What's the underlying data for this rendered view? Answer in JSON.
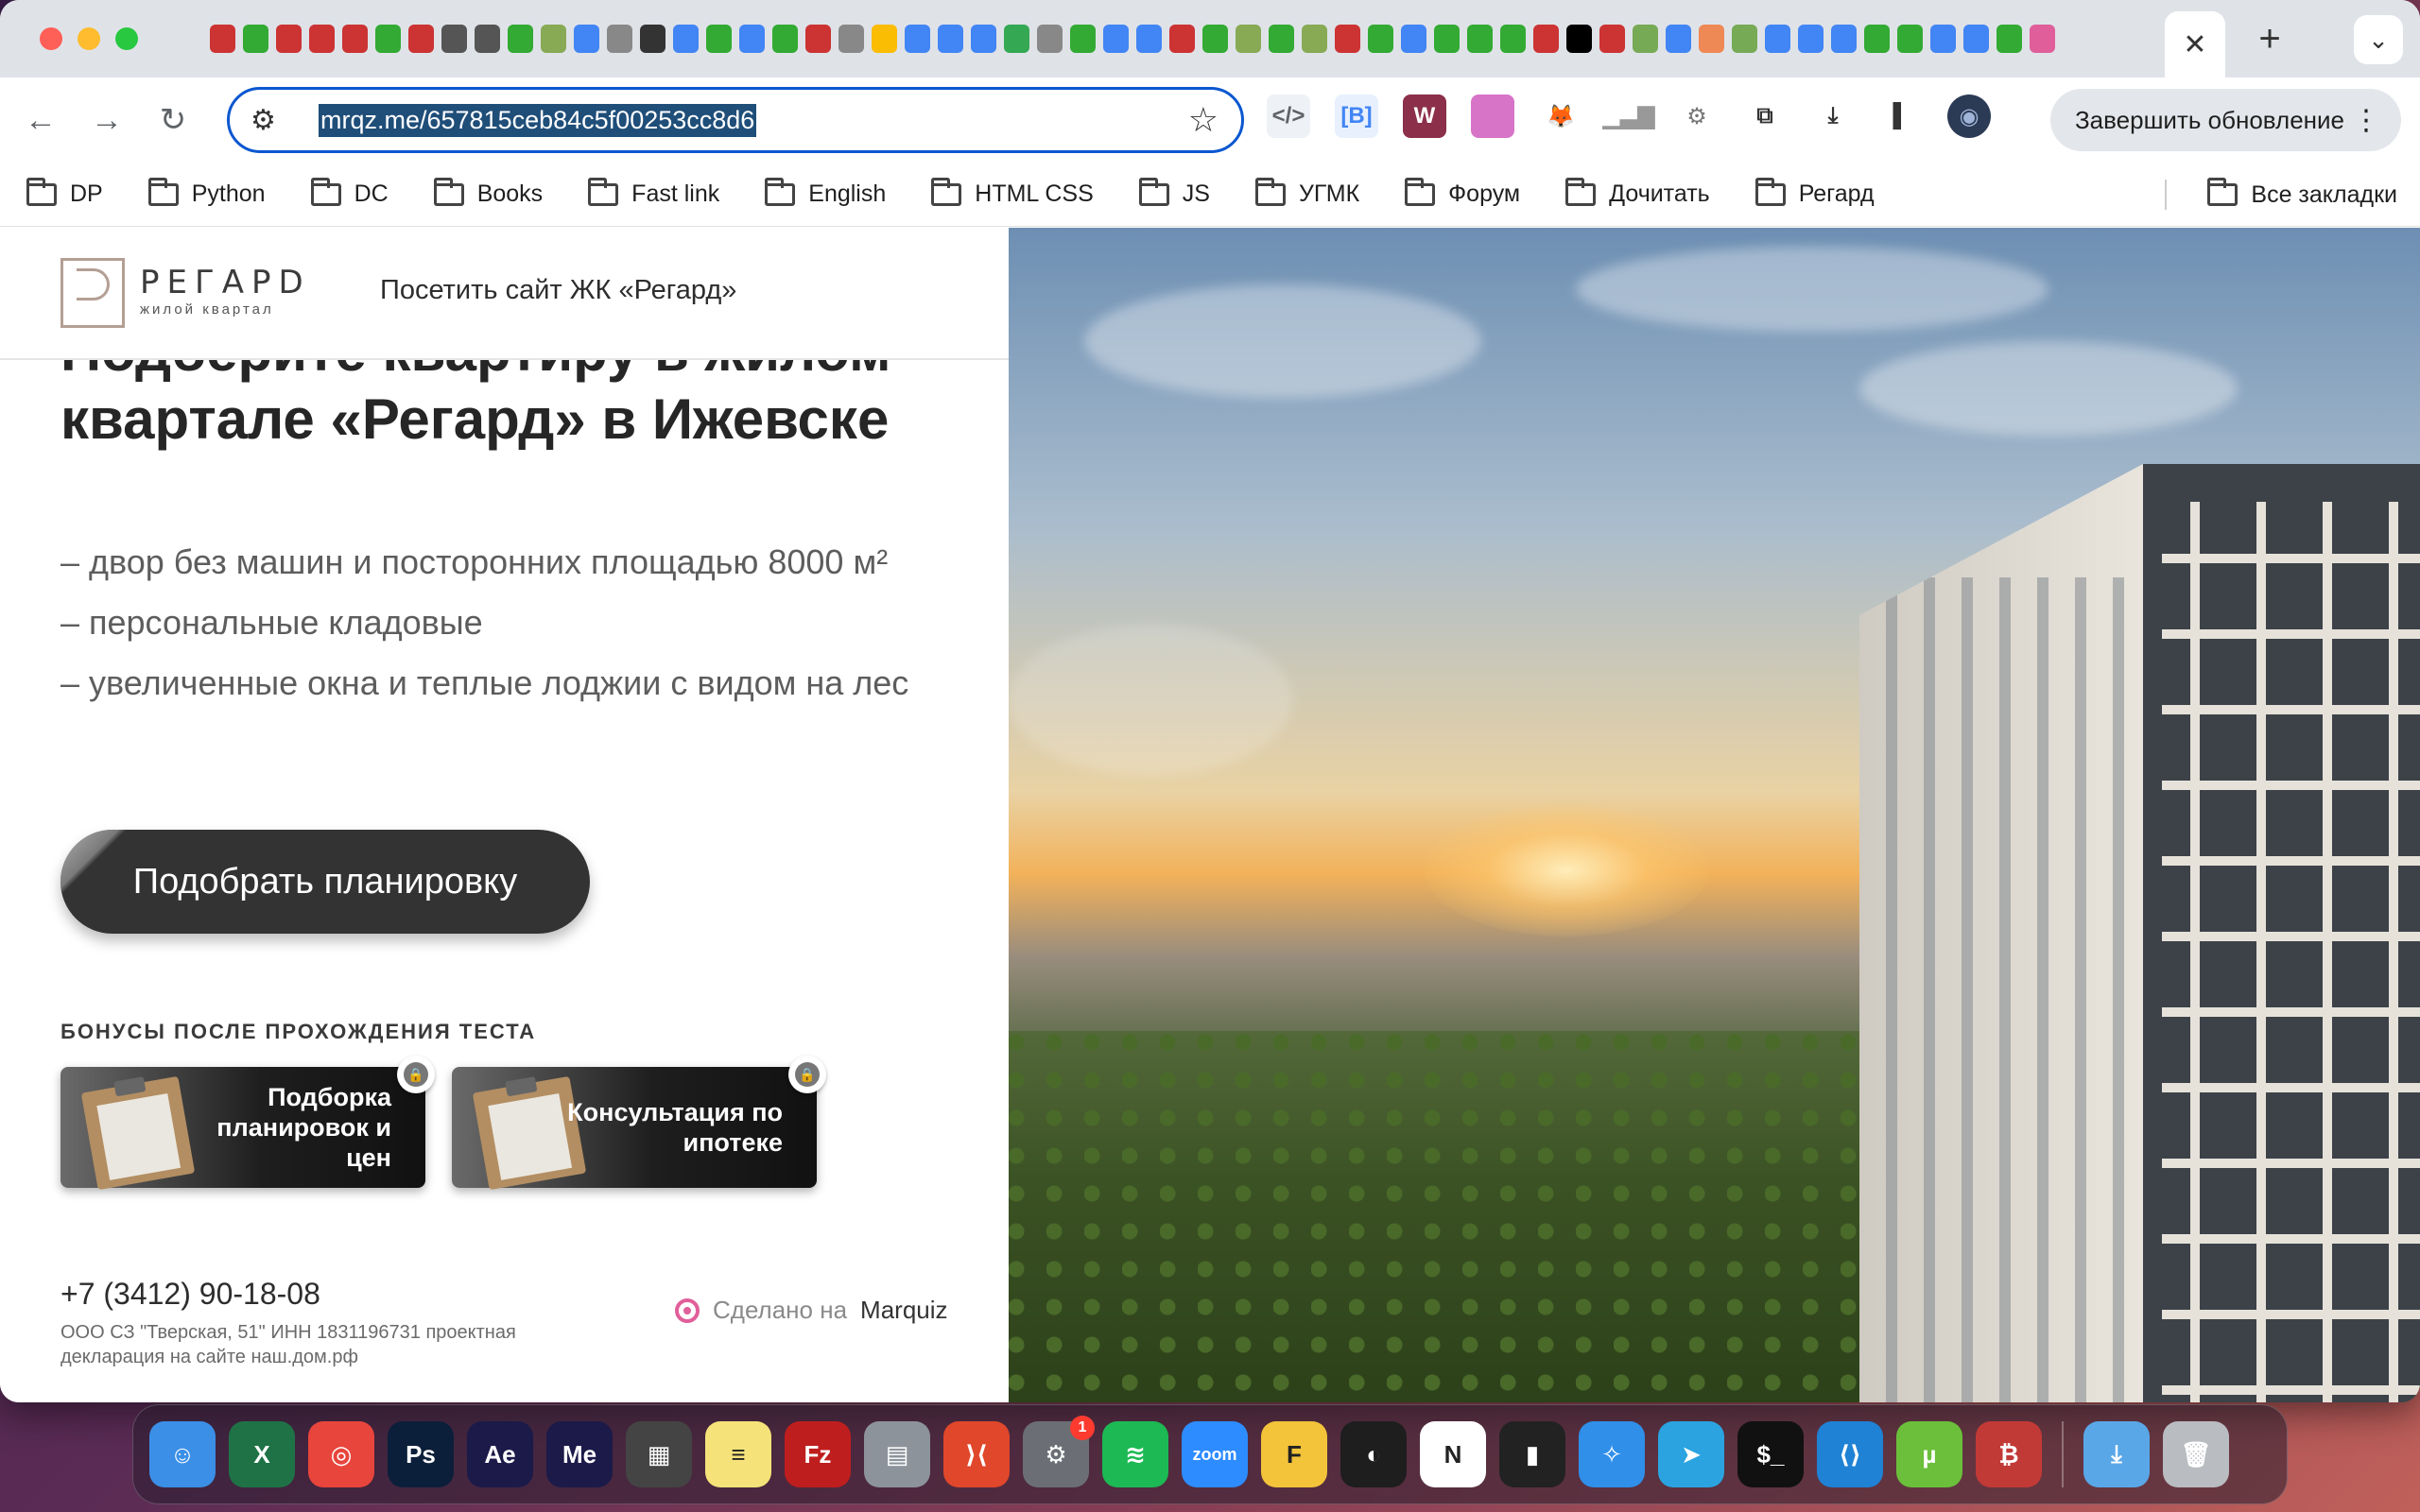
{
  "browser": {
    "url": "mrqz.me/657815ceb84c5f00253cc8d6",
    "close_tab": "✕",
    "new_tab": "+",
    "tab_menu": "⌄",
    "update_button": "Завершить обновление",
    "mini_tab_colors": [
      "#c33",
      "#3a3",
      "#c33",
      "#c33",
      "#c33",
      "#3a3",
      "#c33",
      "#555",
      "#555",
      "#3a3",
      "#8a5",
      "#4285f4",
      "#888",
      "#333",
      "#4285f4",
      "#3a3",
      "#4285f4",
      "#3a3",
      "#c33",
      "#888",
      "#fbbc04",
      "#4285f4",
      "#4285f4",
      "#4285f4",
      "#34a853",
      "#888",
      "#3a3",
      "#4285f4",
      "#4285f4",
      "#c33",
      "#3a3",
      "#8a5",
      "#3a3",
      "#8a5",
      "#c33",
      "#3a3",
      "#4285f4",
      "#3a3",
      "#3a3",
      "#3a3",
      "#c33",
      "#000",
      "#c33",
      "#7a5",
      "#4285f4",
      "#e85",
      "#7a5",
      "#4285f4",
      "#4285f4",
      "#4285f4",
      "#3a3",
      "#3a3",
      "#4285f4",
      "#4285f4",
      "#3a3",
      "#e05f9a"
    ],
    "ext_icons": [
      {
        "name": "code-icon",
        "glyph": "</>",
        "bg": "#eef1f5",
        "color": "#5f6368"
      },
      {
        "name": "bootstrap-ext-icon",
        "glyph": "[B]",
        "bg": "#e8f0fe",
        "color": "#4285f4"
      },
      {
        "name": "w-ext-icon",
        "glyph": "W",
        "bg": "#8b2f4a",
        "color": "#ffffff"
      },
      {
        "name": "gradient-ext-icon",
        "glyph": "",
        "bg": "#d874c8",
        "color": "#ffffff"
      },
      {
        "name": "metamask-icon",
        "glyph": "🦊",
        "bg": "#ffffff",
        "color": "#e2761b"
      },
      {
        "name": "chart-ext-icon",
        "glyph": "▁▃▇",
        "bg": "#ffffff",
        "color": "#999999"
      },
      {
        "name": "gear-ext-icon",
        "glyph": "⚙",
        "bg": "#ffffff",
        "color": "#777777"
      },
      {
        "name": "puzzle-icon",
        "glyph": "⧉",
        "bg": "#ffffff",
        "color": "#333333"
      },
      {
        "name": "download-icon",
        "glyph": "⤓",
        "bg": "#ffffff",
        "color": "#333333"
      },
      {
        "name": "sidepanel-icon",
        "glyph": "▌",
        "bg": "#ffffff",
        "color": "#333333"
      },
      {
        "name": "profile-avatar-icon",
        "glyph": "◉",
        "bg": "#2b3a55",
        "color": "#9fb4d8"
      }
    ]
  },
  "bookmarks": [
    {
      "label": "DP"
    },
    {
      "label": "Python"
    },
    {
      "label": "DC"
    },
    {
      "label": "Books"
    },
    {
      "label": "Fast link"
    },
    {
      "label": "English"
    },
    {
      "label": "HTML CSS"
    },
    {
      "label": "JS"
    },
    {
      "label": "УГМК"
    },
    {
      "label": "Форум"
    },
    {
      "label": "Дочитать"
    },
    {
      "label": "Регард"
    }
  ],
  "all_bookmarks": "Все закладки",
  "site": {
    "logo_title": "РЕГАРD",
    "logo_sub": "жилой квартал",
    "visit_link": "Посетить сайт ЖК «Регард»",
    "headline": "Подберите квартиру в жилом квартале «Регард» в Ижевске",
    "bullets": [
      "– двор без машин и посторонних площадью 8000 м²",
      "– персональные кладовые",
      "– увеличенные окна и теплые лоджии с видом на лес"
    ],
    "cta": "Подобрать планировку",
    "bonus_heading": "БОНУСЫ ПОСЛЕ ПРОХОЖДЕНИЯ ТЕСТА",
    "bonuses": [
      {
        "text": "Подборка планировок и цен"
      },
      {
        "text": "Консультация по ипотеке"
      }
    ],
    "phone": "+7 (3412) 90-18-08",
    "legal": "ООО СЗ \"Тверская, 51\" ИНН 1831196731 проектная декларация на сайте наш.дом.рф",
    "made_on_prefix": "Сделано на",
    "made_on_brand": "Marquiz"
  },
  "dock": {
    "apps": [
      {
        "name": "finder-app-icon",
        "label": "☺",
        "bg": "#3b8fe6"
      },
      {
        "name": "excel-app-icon",
        "label": "X",
        "bg": "#1f7246"
      },
      {
        "name": "chrome-app-icon",
        "label": "◎",
        "bg": "#e8453c"
      },
      {
        "name": "photoshop-app-icon",
        "label": "Ps",
        "bg": "#0c1f3a"
      },
      {
        "name": "after-effects-app-icon",
        "label": "Ae",
        "bg": "#1b1a49"
      },
      {
        "name": "media-encoder-app-icon",
        "label": "Me",
        "bg": "#1b1a49"
      },
      {
        "name": "calculator-app-icon",
        "label": "▦",
        "bg": "#444"
      },
      {
        "name": "notes-app-icon",
        "label": "≡",
        "bg": "#f5e37a"
      },
      {
        "name": "filezilla-app-icon",
        "label": "Fz",
        "bg": "#bf1e1e"
      },
      {
        "name": "database-app-icon",
        "label": "▤",
        "bg": "#8d939b"
      },
      {
        "name": "remote-desktop-app-icon",
        "label": "⟩⟨",
        "bg": "#e0472b"
      },
      {
        "name": "system-settings-app-icon",
        "label": "⚙",
        "bg": "#6b6f75",
        "badge": "1"
      },
      {
        "name": "spotify-app-icon",
        "label": "≋",
        "bg": "#1db954"
      },
      {
        "name": "zoom-app-icon",
        "label": "zoom",
        "bg": "#2d8cff"
      },
      {
        "name": "sublime-app-icon",
        "label": "F",
        "bg": "#f3c33a"
      },
      {
        "name": "figma-app-icon",
        "label": "◐",
        "bg": "#1e1e1e"
      },
      {
        "name": "notion-app-icon",
        "label": "N",
        "bg": "#ffffff"
      },
      {
        "name": "activity-monitor-app-icon",
        "label": "▮",
        "bg": "#222"
      },
      {
        "name": "safari-app-icon",
        "label": "✧",
        "bg": "#2f8fe9"
      },
      {
        "name": "telegram-app-icon",
        "label": "➤",
        "bg": "#2aa3e0"
      },
      {
        "name": "terminal-app-icon",
        "label": "$_",
        "bg": "#111"
      },
      {
        "name": "vscode-app-icon",
        "label": "⟨⟩",
        "bg": "#1f82d4"
      },
      {
        "name": "utorrent-app-icon",
        "label": "µ",
        "bg": "#6bbf3b"
      },
      {
        "name": "git-app-icon",
        "label": "₿",
        "bg": "#c23a36"
      },
      {
        "name": "downloads-folder-icon",
        "label": "⤓",
        "bg": "#5aa7e8"
      },
      {
        "name": "trash-icon",
        "label": "🗑",
        "bg": "#b9bcc0"
      }
    ]
  }
}
